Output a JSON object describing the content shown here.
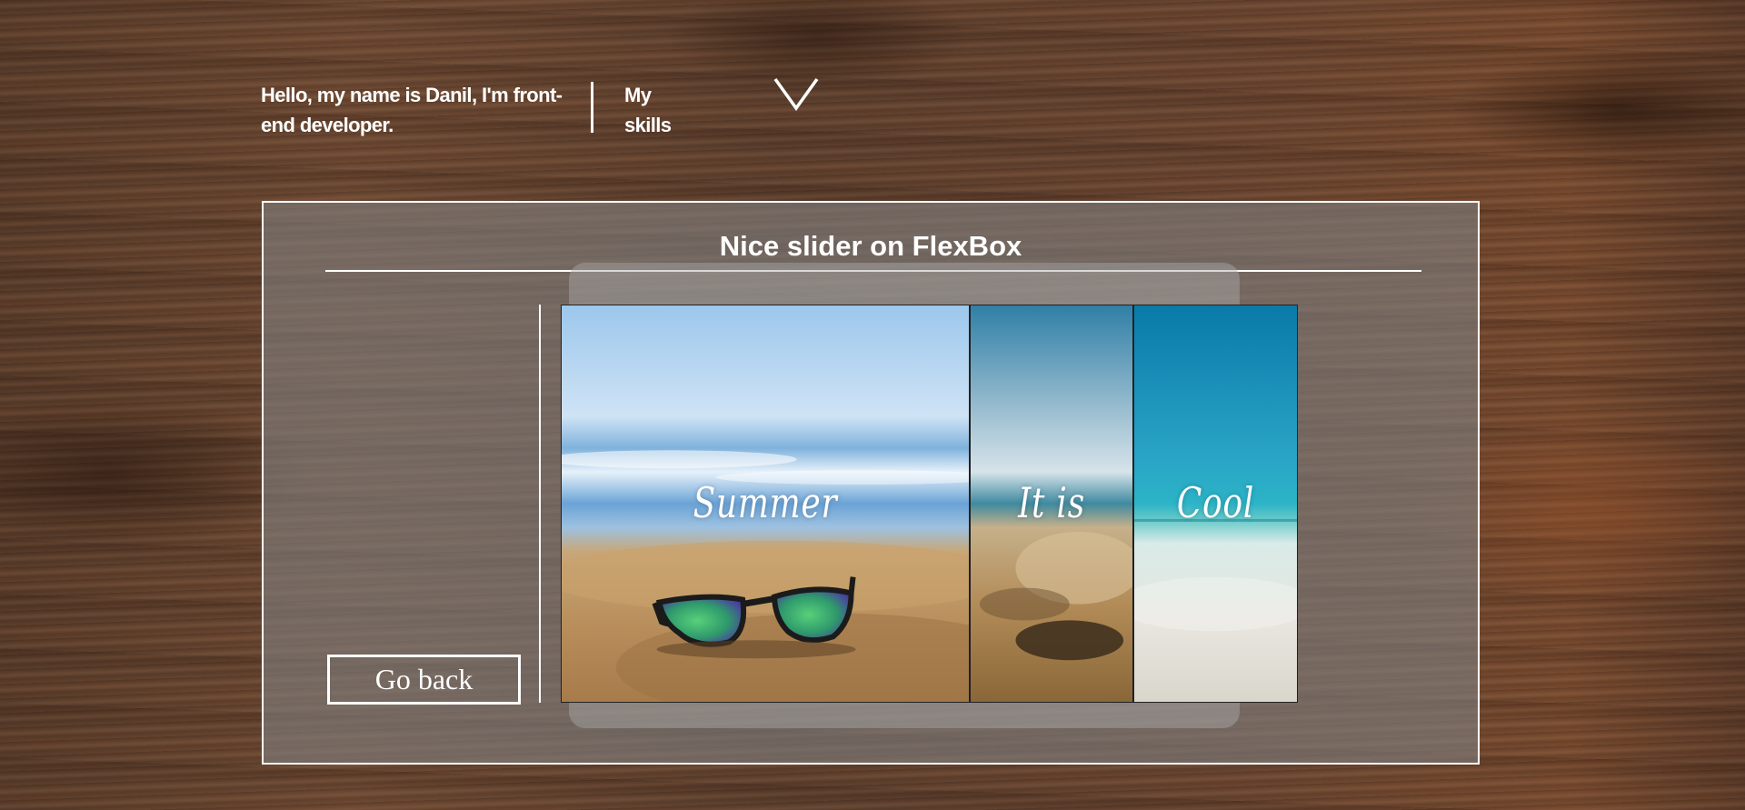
{
  "header": {
    "intro": "Hello, my name is Danil, I'm front-end developer.",
    "skills_label": "My skills",
    "toggle_icon": "chevron-down-icon"
  },
  "panel": {
    "title": "Nice slider on FlexBox",
    "go_back_label": "Go back"
  },
  "slider": {
    "slides": [
      {
        "label": "Summer",
        "image": "beach-sunglasses"
      },
      {
        "label": "It is",
        "image": "sand-footprints"
      },
      {
        "label": "Cool",
        "image": "turquoise-sea"
      }
    ]
  },
  "colors": {
    "panel_overlay": "#808080",
    "text": "#ffffff",
    "wood": "#6a4632"
  }
}
